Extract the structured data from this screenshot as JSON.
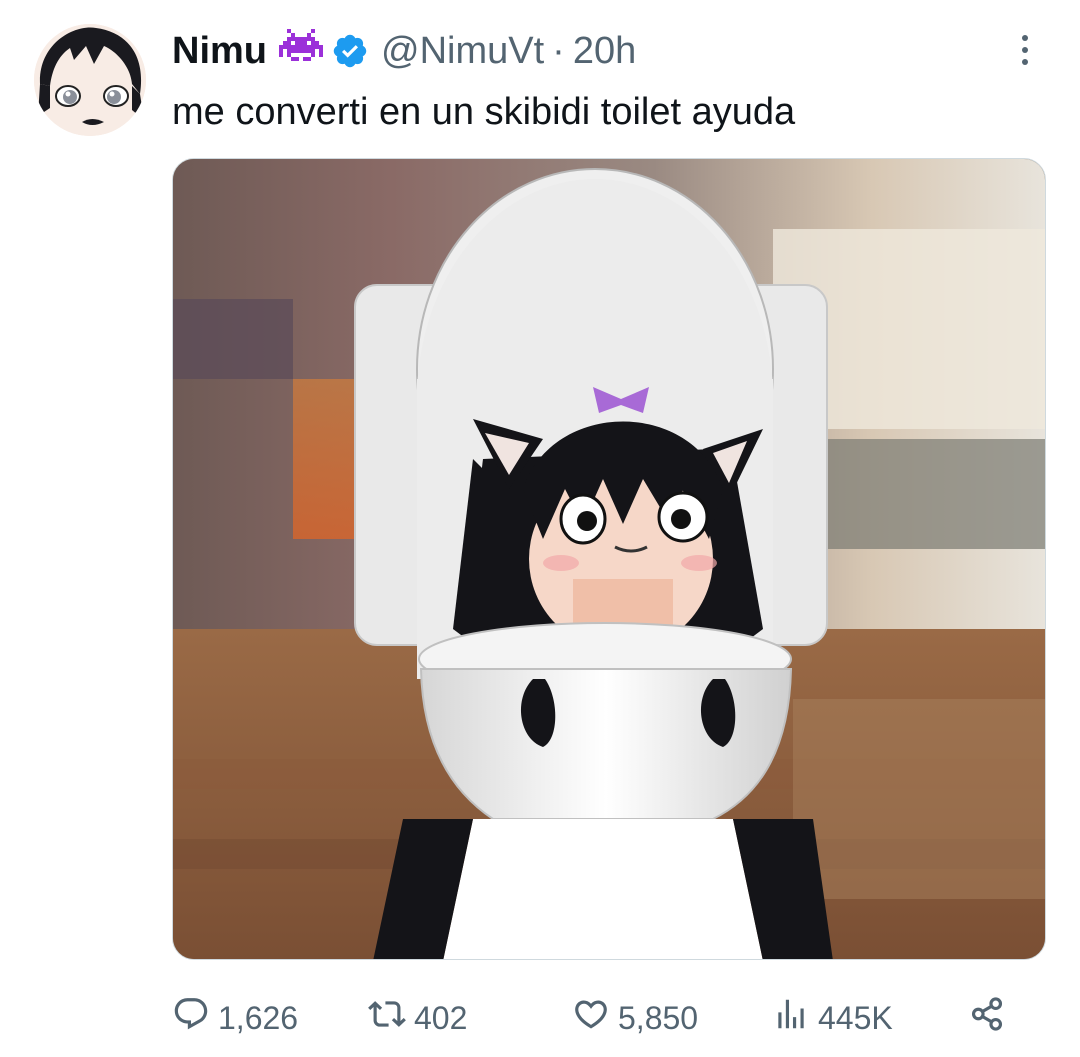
{
  "tweet": {
    "author": {
      "name": "Nimu",
      "handle": "@NimuVt",
      "separator": "·",
      "time": "20h",
      "emoji_icon": "space-invader-icon",
      "verified_icon": "verified-badge-icon",
      "verified_color": "#1d9bf0",
      "emoji_color": "#9b30d9"
    },
    "text": "me converti en un skibidi toilet ayuda",
    "media": {
      "type": "image",
      "subject_icon": "anime-cat-girl-in-toilet-image"
    },
    "actions": {
      "replies": {
        "icon": "reply-icon",
        "count": "1,626"
      },
      "reposts": {
        "icon": "repost-icon",
        "count": "402"
      },
      "likes": {
        "icon": "heart-icon",
        "count": "5,850"
      },
      "views": {
        "icon": "views-chart-icon",
        "count": "445K"
      },
      "share": {
        "icon": "share-icon"
      }
    },
    "menu_icon": "more-vertical-icon"
  },
  "colors": {
    "text_primary": "#0f1419",
    "text_secondary": "#536471",
    "border": "#cfd9de"
  }
}
